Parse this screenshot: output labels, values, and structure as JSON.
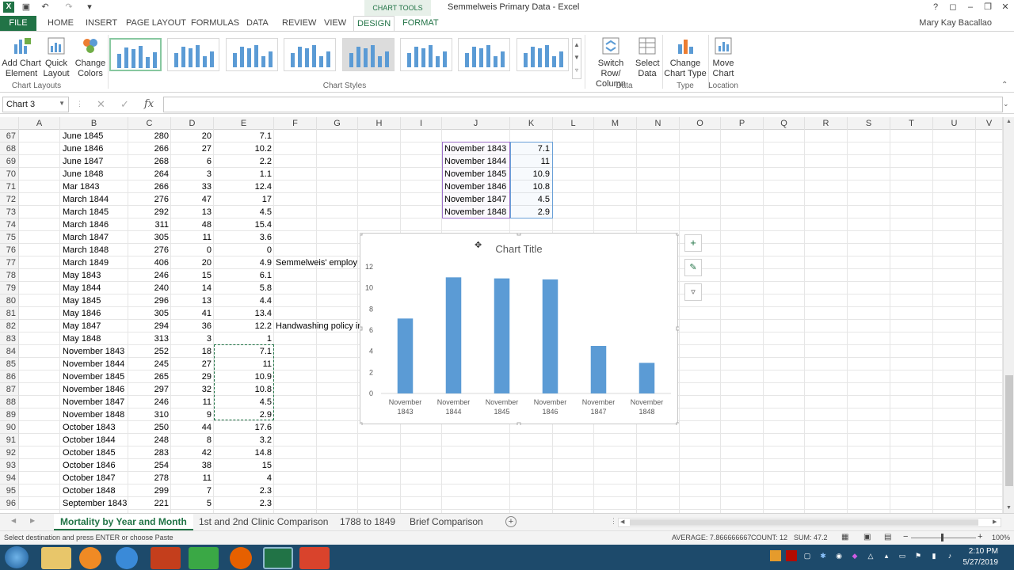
{
  "window": {
    "title": "Semmelweis Primary Data - Excel",
    "context_tab": "CHART TOOLS",
    "user": "Mary Kay Bacallao"
  },
  "tabs": [
    "FILE",
    "HOME",
    "INSERT",
    "PAGE LAYOUT",
    "FORMULAS",
    "DATA",
    "REVIEW",
    "VIEW",
    "DESIGN",
    "FORMAT"
  ],
  "ribbon": {
    "add_chart_element": "Add Chart Element",
    "quick_layout": "Quick Layout",
    "change_colors": "Change Colors",
    "chart_layouts_label": "Chart Layouts",
    "chart_styles_label": "Chart Styles",
    "switch_row_col": "Switch Row/ Column",
    "select_data": "Select Data",
    "data_label": "Data",
    "change_chart_type": "Change Chart Type",
    "type_label": "Type",
    "move_chart": "Move Chart",
    "location_label": "Location"
  },
  "formula_bar": {
    "name_box": "Chart 3",
    "fx": "fx",
    "value": ""
  },
  "columns": [
    "A",
    "B",
    "C",
    "D",
    "E",
    "F",
    "G",
    "H",
    "I",
    "J",
    "K",
    "L",
    "M",
    "N",
    "O",
    "P",
    "Q",
    "R",
    "S",
    "T",
    "U",
    "V"
  ],
  "rows": [
    {
      "n": "67",
      "b": "June 1845",
      "c": "280",
      "d": "20",
      "e": "7.1"
    },
    {
      "n": "68",
      "b": "June 1846",
      "c": "266",
      "d": "27",
      "e": "10.2"
    },
    {
      "n": "69",
      "b": "June 1847",
      "c": "268",
      "d": "6",
      "e": "2.2"
    },
    {
      "n": "70",
      "b": "June 1848",
      "c": "264",
      "d": "3",
      "e": "1.1"
    },
    {
      "n": "71",
      "b": "Mar 1843",
      "c": "266",
      "d": "33",
      "e": "12.4"
    },
    {
      "n": "72",
      "b": "March 1844",
      "c": "276",
      "d": "47",
      "e": "17"
    },
    {
      "n": "73",
      "b": "March 1845",
      "c": "292",
      "d": "13",
      "e": "4.5"
    },
    {
      "n": "74",
      "b": "March 1846",
      "c": "311",
      "d": "48",
      "e": "15.4"
    },
    {
      "n": "75",
      "b": "March 1847",
      "c": "305",
      "d": "11",
      "e": "3.6"
    },
    {
      "n": "76",
      "b": "March 1848",
      "c": "276",
      "d": "0",
      "e": "0"
    },
    {
      "n": "77",
      "b": "March 1849",
      "c": "406",
      "d": "20",
      "e": "4.9"
    },
    {
      "n": "78",
      "b": "May 1843",
      "c": "246",
      "d": "15",
      "e": "6.1"
    },
    {
      "n": "79",
      "b": "May 1844",
      "c": "240",
      "d": "14",
      "e": "5.8"
    },
    {
      "n": "80",
      "b": "May 1845",
      "c": "296",
      "d": "13",
      "e": "4.4"
    },
    {
      "n": "81",
      "b": "May 1846",
      "c": "305",
      "d": "41",
      "e": "13.4"
    },
    {
      "n": "82",
      "b": "May 1847",
      "c": "294",
      "d": "36",
      "e": "12.2"
    },
    {
      "n": "83",
      "b": "May 1848",
      "c": "313",
      "d": "3",
      "e": "1"
    },
    {
      "n": "84",
      "b": "November 1843",
      "c": "252",
      "d": "18",
      "e": "7.1"
    },
    {
      "n": "85",
      "b": "November 1844",
      "c": "245",
      "d": "27",
      "e": "11"
    },
    {
      "n": "86",
      "b": "November 1845",
      "c": "265",
      "d": "29",
      "e": "10.9"
    },
    {
      "n": "87",
      "b": "November 1846",
      "c": "297",
      "d": "32",
      "e": "10.8"
    },
    {
      "n": "88",
      "b": "November 1847",
      "c": "246",
      "d": "11",
      "e": "4.5"
    },
    {
      "n": "89",
      "b": "November 1848",
      "c": "310",
      "d": "9",
      "e": "2.9"
    },
    {
      "n": "90",
      "b": "October 1843",
      "c": "250",
      "d": "44",
      "e": "17.6"
    },
    {
      "n": "91",
      "b": "October 1844",
      "c": "248",
      "d": "8",
      "e": "3.2"
    },
    {
      "n": "92",
      "b": "October 1845",
      "c": "283",
      "d": "42",
      "e": "14.8"
    },
    {
      "n": "93",
      "b": "October 1846",
      "c": "254",
      "d": "38",
      "e": "15"
    },
    {
      "n": "94",
      "b": "October 1847",
      "c": "278",
      "d": "11",
      "e": "4"
    },
    {
      "n": "95",
      "b": "October 1848",
      "c": "299",
      "d": "7",
      "e": "2.3"
    },
    {
      "n": "96",
      "b": "September 1843",
      "c": "221",
      "d": "5",
      "e": "2.3"
    }
  ],
  "f_notes": {
    "row77": "Semmelweis' employ",
    "row82": "Handwashing policy in"
  },
  "jk_table": [
    {
      "j": "November 1843",
      "k": "7.1"
    },
    {
      "j": "November 1844",
      "k": "11"
    },
    {
      "j": "November 1845",
      "k": "10.9"
    },
    {
      "j": "November 1846",
      "k": "10.8"
    },
    {
      "j": "November 1847",
      "k": "4.5"
    },
    {
      "j": "November 1848",
      "k": "2.9"
    }
  ],
  "chart_data": {
    "type": "bar",
    "title": "Chart Title",
    "categories": [
      [
        "November",
        "1843"
      ],
      [
        "November",
        "1844"
      ],
      [
        "November",
        "1845"
      ],
      [
        "November",
        "1846"
      ],
      [
        "November",
        "1847"
      ],
      [
        "November",
        "1848"
      ]
    ],
    "values": [
      7.1,
      11,
      10.9,
      10.8,
      4.5,
      2.9
    ],
    "ylim": [
      0,
      12
    ],
    "yticks": [
      "0",
      "2",
      "4",
      "6",
      "8",
      "10",
      "12"
    ],
    "xlabel": "",
    "ylabel": "",
    "bar_color": "#5b9bd5",
    "grid": false
  },
  "sheet_tabs": [
    "Mortality by Year and Month",
    "1st and 2nd Clinic Comparison",
    "1788 to 1849",
    "Brief Comparison"
  ],
  "status": {
    "message": "Select destination and press ENTER or choose Paste",
    "average": "AVERAGE: 7.866666667",
    "count": "COUNT: 12",
    "sum": "SUM: 47.2",
    "zoom": "100%"
  },
  "taskbar": {
    "time": "2:10 PM",
    "date": "5/27/2019"
  },
  "colors": {
    "excel_green": "#217346",
    "selection_purple": "#9b6fc8",
    "selection_blue": "#6aa0d8"
  }
}
